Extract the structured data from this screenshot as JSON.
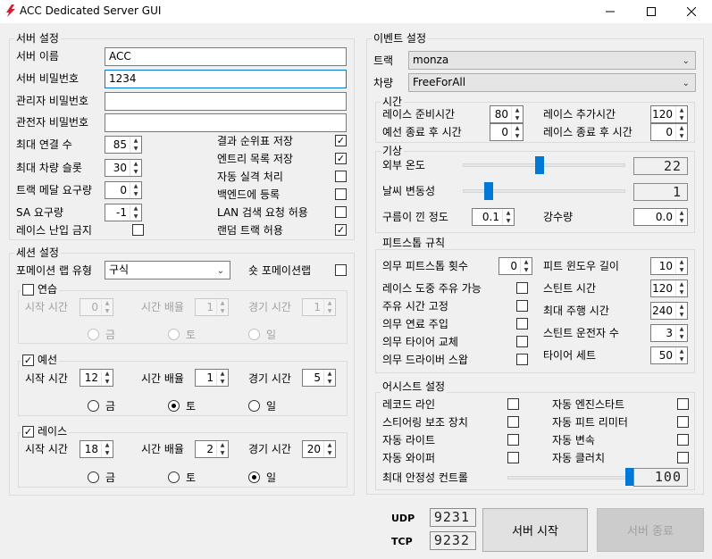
{
  "window": {
    "title": "ACC Dedicated Server GUI"
  },
  "server": {
    "group_label": "서버 설정",
    "name_label": "서버 이름",
    "name_value": "ACC",
    "password_label": "서버 비밀번호",
    "password_value": "1234",
    "admin_password_label": "관리자 비밀번호",
    "admin_password_value": "",
    "spectator_password_label": "관전자 비밀번호",
    "spectator_password_value": "",
    "max_connections_label": "최대 연결 수",
    "max_connections": "85",
    "max_car_slots_label": "최대 차량 슬롯",
    "max_car_slots": "30",
    "track_medals_label": "트랙 메달 요구량",
    "track_medals": "0",
    "sa_label": "SA 요구량",
    "sa": "-1",
    "race_lock_label": "레이스 난입 금지",
    "save_results_label": "결과 순위표 저장",
    "save_entry_label": "엔트리 목록 저장",
    "auto_dq_label": "자동 실격 처리",
    "register_backend_label": "백엔드에 등록",
    "lan_discovery_label": "LAN 검색 요청 허용",
    "random_track_label": "랜덤 트랙 허용"
  },
  "session": {
    "group_label": "세션 설정",
    "formation_label": "포메이션 랩 유형",
    "formation_value": "구식",
    "short_formation_label": "숏 포메이션랩",
    "start_time_label": "시작 시간",
    "time_mult_label": "시간 배율",
    "duration_label": "경기 시간",
    "day_fri": "금",
    "day_sat": "토",
    "day_sun": "일",
    "practice": {
      "label": "연습",
      "start": "0",
      "mult": "1",
      "duration": "1"
    },
    "qualify": {
      "label": "예선",
      "start": "12",
      "mult": "1",
      "duration": "5"
    },
    "race": {
      "label": "레이스",
      "start": "18",
      "mult": "2",
      "duration": "20"
    }
  },
  "event": {
    "group_label": "이벤트 설정",
    "track_label": "트랙",
    "track_value": "monza",
    "car_label": "차량",
    "car_value": "FreeForAll",
    "time": {
      "group_label": "시간",
      "pre_race_label": "레이스 준비시간",
      "pre_race": "80",
      "overtime_label": "레이스 추가시간",
      "overtime": "120",
      "post_qualy_label": "예선 종료 후 시간",
      "post_qualy": "0",
      "post_race_label": "레이스 종료 후 시간",
      "post_race": "0"
    },
    "weather": {
      "group_label": "기상",
      "ambient_label": "외부 온도",
      "ambient_value": "22",
      "randomness_label": "날씨 변동성",
      "randomness_value": "1",
      "cloud_label": "구름이 낀 정도",
      "cloud_value": "0.1",
      "rain_label": "강수량",
      "rain_value": "0.0",
      "ambient_fraction": 0.47,
      "randomness_fraction": 0.14
    },
    "pit": {
      "group_label": "피트스톱 규칙",
      "mandatory_count_label": "의무 피트스톱 횟수",
      "mandatory_count": "0",
      "pit_window_label": "피트 윈도우 길이",
      "pit_window": "10",
      "refuel_allowed_label": "레이스 도중 주유 가능",
      "stint_time_label": "스틴트 시간",
      "stint_time": "120",
      "fixed_refuel_label": "주유 시간 고정",
      "max_drive_label": "최대 주행 시간",
      "max_drive": "240",
      "mandatory_refuel_label": "의무 연료 주입",
      "driver_stint_label": "스틴트 운전자 수",
      "driver_stint": "3",
      "mandatory_tyre_label": "의무 타이어 교체",
      "tyre_sets_label": "타이어 세트",
      "tyre_sets": "50",
      "mandatory_swap_label": "의무 드라이버 스왑"
    },
    "assists": {
      "group_label": "어시스트 설정",
      "racing_line_label": "레코드 라인",
      "auto_engine_label": "자동 엔진스타트",
      "steering_label": "스티어링 보조 장치",
      "auto_pit_limiter_label": "자동 피트 리미터",
      "auto_lights_label": "자동 라이트",
      "auto_gear_label": "자동 변속",
      "auto_wiper_label": "자동 와이퍼",
      "auto_clutch_label": "자동 클러치",
      "stability_label": "최대 안정성 컨트롤",
      "stability_value": "100",
      "stability_fraction": 1.0
    }
  },
  "footer": {
    "udp_label": "UDP",
    "udp_value": "9231",
    "tcp_label": "TCP",
    "tcp_value": "9232",
    "start_label": "서버 시작",
    "stop_label": "서버 종료"
  }
}
